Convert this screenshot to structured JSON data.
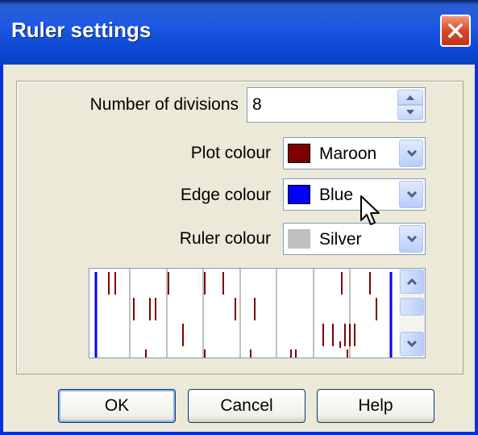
{
  "dialog": {
    "title": "Ruler settings"
  },
  "fields": {
    "divisions_label": "Number of divisions",
    "divisions_value": "8",
    "plot_colour_label": "Plot colour",
    "plot_colour_value": "Maroon",
    "edge_colour_label": "Edge colour",
    "edge_colour_value": "Blue",
    "ruler_colour_label": "Ruler colour",
    "ruler_colour_value": "Silver"
  },
  "colors": {
    "plot": "#800000",
    "edge": "#0000ff",
    "ruler": "#c0c0c0",
    "title_bar": "#0a46d6"
  },
  "buttons": {
    "ok": "OK",
    "cancel": "Cancel",
    "help": "Help"
  },
  "icons": [
    "close-icon",
    "spin-up-icon",
    "spin-down-icon",
    "chevron-down-icon",
    "scroll-up-icon",
    "scroll-down-icon",
    "mouse-pointer-icon"
  ]
}
